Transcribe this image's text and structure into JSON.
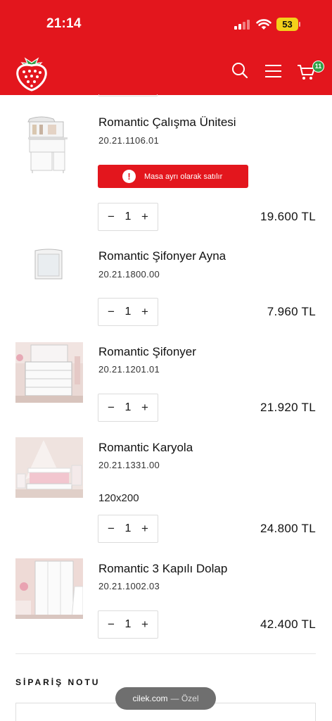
{
  "status_bar": {
    "time": "21:14",
    "battery": "53"
  },
  "header": {
    "logo_icon": "strawberry-logo",
    "search_icon": "search-icon",
    "menu_icon": "menu-icon",
    "cart_icon": "cart-icon",
    "cart_count": "11"
  },
  "cart_items": [
    {
      "name": "Romantic Çalışma Ünitesi",
      "sku": "20.21.1106.01",
      "notice": "Masa ayrı olarak satılır",
      "quantity": "1",
      "price": "19.600 TL"
    },
    {
      "name": "Romantic Şifonyer Ayna",
      "sku": "20.21.1800.00",
      "quantity": "1",
      "price": "7.960 TL"
    },
    {
      "name": "Romantic Şifonyer",
      "sku": "20.21.1201.01",
      "quantity": "1",
      "price": "21.920 TL"
    },
    {
      "name": "Romantic Karyola",
      "sku": "20.21.1331.00",
      "variant": "120x200",
      "quantity": "1",
      "price": "24.800 TL"
    },
    {
      "name": "Romantic 3 Kapılı Dolap",
      "sku": "20.21.1002.03",
      "quantity": "1",
      "price": "42.400 TL"
    }
  ],
  "qty_controls": {
    "minus": "−",
    "plus": "+"
  },
  "order_note": {
    "title": "SİPARİŞ NOTU"
  },
  "browser": {
    "host": "cilek.com",
    "mode": "— Özel"
  },
  "colors": {
    "brand": "#e3161d",
    "badge": "#30a146"
  }
}
